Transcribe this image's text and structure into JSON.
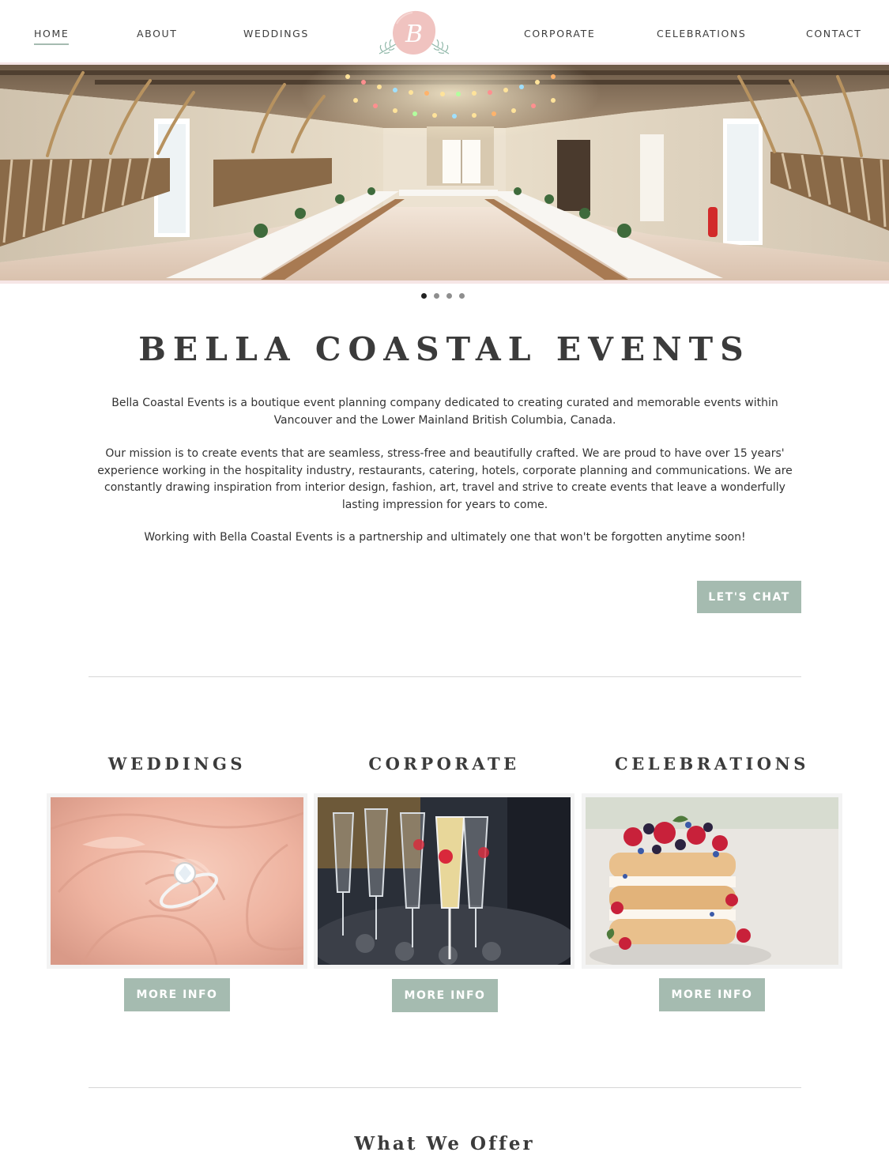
{
  "nav": {
    "items": [
      {
        "label": "HOME"
      },
      {
        "label": "ABOUT"
      },
      {
        "label": "WEDDINGS"
      },
      {
        "label": "CORPORATE"
      },
      {
        "label": "CELEBRATIONS"
      },
      {
        "label": "CONTACT"
      }
    ],
    "logo_letter": "B"
  },
  "hero": {
    "slides_total": 4,
    "active_slide": 1
  },
  "intro": {
    "title": "BELLA COASTAL EVENTS",
    "paragraph1": "Bella Coastal Events is a boutique event planning company dedicated to creating curated and memorable events within Vancouver and the Lower Mainland British Columbia, Canada.",
    "paragraph2": "Our mission is to create events that are seamless, stress-free and beautifully crafted. We are proud to have over 15 years' experience working in the hospitality industry, restaurants, catering, hotels, corporate planning and communications.  We are constantly drawing inspiration from interior design, fashion, art, travel and strive to create events that leave a wonderfully lasting impression for years to come.",
    "paragraph3": "Working with Bella Coastal Events is a partnership and ultimately one that won't be forgotten anytime soon!",
    "cta_label": "LET'S CHAT"
  },
  "services": [
    {
      "title": "WEDDINGS",
      "button": "MORE INFO"
    },
    {
      "title": "CORPORATE",
      "button": "MORE INFO"
    },
    {
      "title": "CELEBRATIONS",
      "button": "MORE INFO"
    }
  ],
  "offer": {
    "title": "What We Offer"
  },
  "colors": {
    "accent": "#a5bbb0",
    "blush": "#f6e6e6",
    "logo_pink": "#f0c3c0",
    "text": "#3b3b3b"
  }
}
